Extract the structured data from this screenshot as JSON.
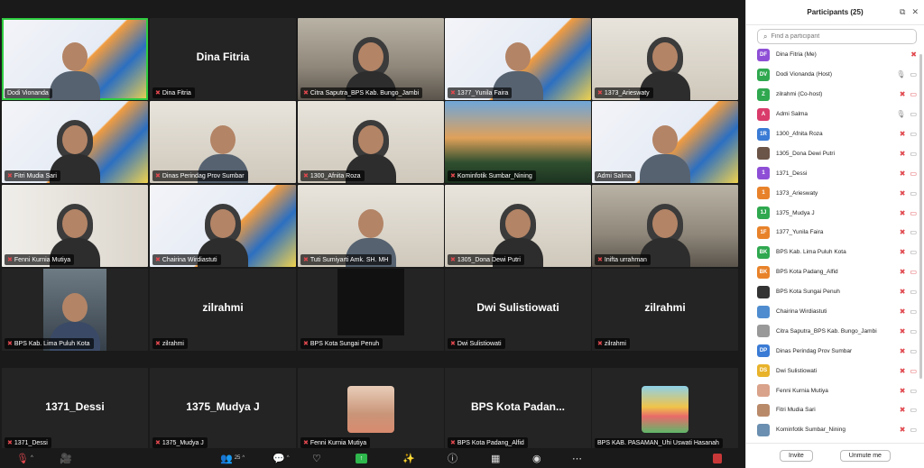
{
  "tiles": [
    {
      "name": "Dodi Vionanda",
      "muted": false,
      "kind": "video slide-person",
      "active": true
    },
    {
      "name": "Dina Fitria",
      "muted": true,
      "kind": "name",
      "center": "Dina Fitria"
    },
    {
      "name": "Citra Saputra_BPS Kab. Bungo_Jambi",
      "muted": true,
      "kind": "video office"
    },
    {
      "name": "1377_Yunila Faira",
      "muted": true,
      "kind": "video slide"
    },
    {
      "name": "1373_Arieswaty",
      "muted": true,
      "kind": "video room"
    },
    {
      "name": "Fitri Mudia Sari",
      "muted": true,
      "kind": "video slide"
    },
    {
      "name": "Dinas Perindag Prov Sumbar",
      "muted": true,
      "kind": "video room"
    },
    {
      "name": "1300_Afnita Roza",
      "muted": true,
      "kind": "video room"
    },
    {
      "name": "Kominfotik Sumbar_Nining",
      "muted": true,
      "kind": "video scenery"
    },
    {
      "name": "Admi Salma",
      "muted": false,
      "kind": "video slide"
    },
    {
      "name": "Fenni Kurnia Mutiya",
      "muted": true,
      "kind": "video shelf"
    },
    {
      "name": "Chairina Wirdiastuti",
      "muted": true,
      "kind": "video slide"
    },
    {
      "name": "Tuti Sumiyarti Amk. SH. MH",
      "muted": true,
      "kind": "video room"
    },
    {
      "name": "1305_Dona Dewi Putri",
      "muted": true,
      "kind": "video room"
    },
    {
      "name": "Inifta urrahman",
      "muted": true,
      "kind": "video office"
    },
    {
      "name": "BPS Kab. Lima Puluh Kota",
      "muted": true,
      "kind": "inner-video"
    },
    {
      "name": "zilrahmi",
      "muted": true,
      "kind": "name",
      "center": "zilrahmi"
    },
    {
      "name": "BPS Kota Sungai Penuh",
      "muted": true,
      "kind": "black-box"
    },
    {
      "name": "Dwi Sulistiowati",
      "muted": true,
      "kind": "name",
      "center": "Dwi Sulistiowati"
    },
    {
      "name": "zilrahmi",
      "muted": true,
      "kind": "name",
      "center": "zilrahmi"
    },
    {
      "name": "1371_Dessi",
      "muted": true,
      "kind": "name",
      "center": "1371_Dessi"
    },
    {
      "name": "1375_Mudya J",
      "muted": true,
      "kind": "name",
      "center": "1375_Mudya J"
    },
    {
      "name": "Fenni Kurnia Mutiya",
      "muted": true,
      "kind": "photo"
    },
    {
      "name": "BPS Kota Padang_Alfid",
      "muted": true,
      "kind": "name",
      "center": "BPS Kota Padan..."
    },
    {
      "name": "BPS KAB. PASAMAN_Uhi Uswati Hasanah",
      "muted": false,
      "kind": "photo-art"
    }
  ],
  "sidebar": {
    "title": "Participants (25)",
    "search_placeholder": "Find a participant",
    "invite_label": "Invite",
    "unmute_label": "Unmute me",
    "participants": [
      {
        "initials": "DF",
        "color": "#8e4fd6",
        "name": "Dina Fitria (Me)",
        "mic": "muted",
        "cam": "none"
      },
      {
        "initials": "DV",
        "color": "#2fa84f",
        "name": "Dodi Vionanda (Host)",
        "mic": "on",
        "cam": "on"
      },
      {
        "initials": "Z",
        "color": "#2fa84f",
        "name": "zilrahmi (Co-host)",
        "mic": "muted",
        "cam": "off"
      },
      {
        "initials": "A",
        "color": "#d93b6a",
        "name": "Admi Salma",
        "mic": "on",
        "cam": "on"
      },
      {
        "initials": "1R",
        "color": "#3a7bd5",
        "name": "1300_Afnita Roza",
        "mic": "muted",
        "cam": "on"
      },
      {
        "initials": "",
        "color": "#6b5448",
        "name": "1305_Dona Dewi Putri",
        "mic": "muted",
        "cam": "on"
      },
      {
        "initials": "1",
        "color": "#8e4fd6",
        "name": "1371_Dessi",
        "mic": "muted",
        "cam": "off"
      },
      {
        "initials": "1",
        "color": "#e8822a",
        "name": "1373_Arieswaty",
        "mic": "muted",
        "cam": "on"
      },
      {
        "initials": "1J",
        "color": "#2fa84f",
        "name": "1375_Mudya J",
        "mic": "muted",
        "cam": "off"
      },
      {
        "initials": "1F",
        "color": "#e8822a",
        "name": "1377_Yunila Faira",
        "mic": "muted",
        "cam": "on"
      },
      {
        "initials": "BK",
        "color": "#2fa84f",
        "name": "BPS Kab. Lima Puluh Kota",
        "mic": "muted",
        "cam": "on"
      },
      {
        "initials": "BK",
        "color": "#e8822a",
        "name": "BPS Kota Padang_Alfid",
        "mic": "muted",
        "cam": "off"
      },
      {
        "initials": "",
        "color": "#333333",
        "name": "BPS Kota Sungai Penuh",
        "mic": "muted",
        "cam": "on"
      },
      {
        "initials": "",
        "color": "#4f8ccf",
        "name": "Chairina Wirdiastuti",
        "mic": "muted",
        "cam": "on"
      },
      {
        "initials": "",
        "color": "#999999",
        "name": "Citra Saputra_BPS Kab. Bungo_Jambi",
        "mic": "muted",
        "cam": "on"
      },
      {
        "initials": "DP",
        "color": "#3a7bd5",
        "name": "Dinas Perindag Prov Sumbar",
        "mic": "muted",
        "cam": "on"
      },
      {
        "initials": "DS",
        "color": "#e8b22a",
        "name": "Dwi Sulistiowati",
        "mic": "muted",
        "cam": "off"
      },
      {
        "initials": "",
        "color": "#d9a28a",
        "name": "Fenni Kurnia Mutiya",
        "mic": "muted",
        "cam": "on"
      },
      {
        "initials": "",
        "color": "#b98a6a",
        "name": "Fitri Mudia Sari",
        "mic": "muted",
        "cam": "on"
      },
      {
        "initials": "",
        "color": "#6a8fb0",
        "name": "Kominfotik Sumbar_Nining",
        "mic": "muted",
        "cam": "on"
      }
    ]
  },
  "toolbar": {
    "participants_count": "25"
  }
}
